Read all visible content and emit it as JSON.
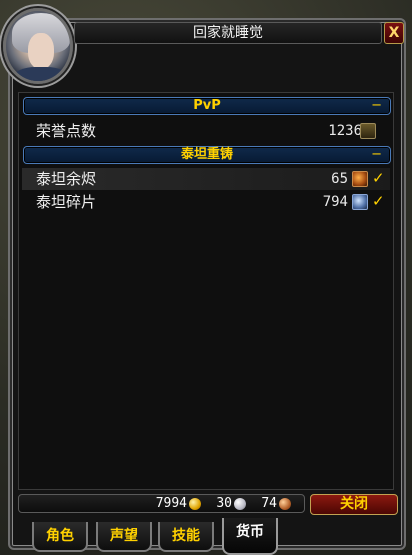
{
  "window": {
    "title": "回家就睡觉",
    "close_glyph": "X"
  },
  "categories": [
    {
      "title": "PvP",
      "collapse_glyph": "−",
      "rows": [
        {
          "label": "荣誉点数",
          "value": "1236",
          "icon": "honor-icon",
          "tracked": false
        }
      ]
    },
    {
      "title": "泰坦重铸",
      "collapse_glyph": "−",
      "rows": [
        {
          "label": "泰坦余烬",
          "value": "65",
          "icon": "titan-ember-icon",
          "tracked": true
        },
        {
          "label": "泰坦碎片",
          "value": "794",
          "icon": "titan-shard-icon",
          "tracked": true
        }
      ]
    }
  ],
  "money": {
    "gold": "7994",
    "silver": "30",
    "copper": "74"
  },
  "buttons": {
    "close_label": "关闭"
  },
  "tabs": [
    {
      "label": "角色",
      "active": false
    },
    {
      "label": "声望",
      "active": false
    },
    {
      "label": "技能",
      "active": false
    },
    {
      "label": "货币",
      "active": true
    }
  ],
  "colors": {
    "header_text": "#ffd100",
    "header_border": "#4a7ab8",
    "close_button": "#8c1a10"
  }
}
